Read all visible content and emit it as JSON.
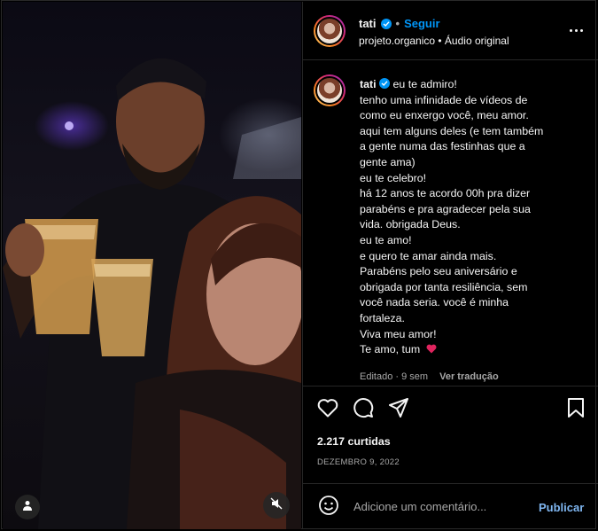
{
  "header": {
    "username": "tati",
    "separator": "•",
    "follow_label": "Seguir",
    "audio_line": "projeto.organico • Áudio original"
  },
  "caption": {
    "username": "tati",
    "lines": [
      "eu te admiro!",
      "tenho uma infinidade de vídeos de",
      "como eu enxergo você, meu amor.",
      "aqui tem alguns deles (e tem também",
      "a gente numa das festinhas que a",
      "gente ama)",
      "eu te celebro!",
      "há 12 anos te acordo 00h pra dizer",
      "parabéns e pra agradecer pela sua",
      "vida. obrigada Deus.",
      "eu te amo!",
      "e quero te amar ainda mais.",
      "Parabéns pelo seu aniversário e",
      "obrigada por tanta resiliência, sem",
      "você nada seria. você é minha",
      "fortaleza.",
      "Viva meu amor!",
      "Te amo, tum"
    ],
    "edited_label": "Editado · 9 sem",
    "translate_label": "Ver tradução"
  },
  "stats": {
    "likes": "2.217 curtidas",
    "date": "DEZEMBRO 9, 2022"
  },
  "comment": {
    "placeholder": "Adicione um comentário...",
    "publish_label": "Publicar"
  },
  "colors": {
    "background": "#000000",
    "accent": "#0095f6",
    "muted": "#a8a8a8",
    "heart": "#ed4956"
  },
  "icons": [
    "user-tag-icon",
    "mute-icon",
    "more-icon",
    "heart-icon",
    "comment-icon",
    "share-icon",
    "save-icon",
    "emoji-icon",
    "verified-icon"
  ]
}
